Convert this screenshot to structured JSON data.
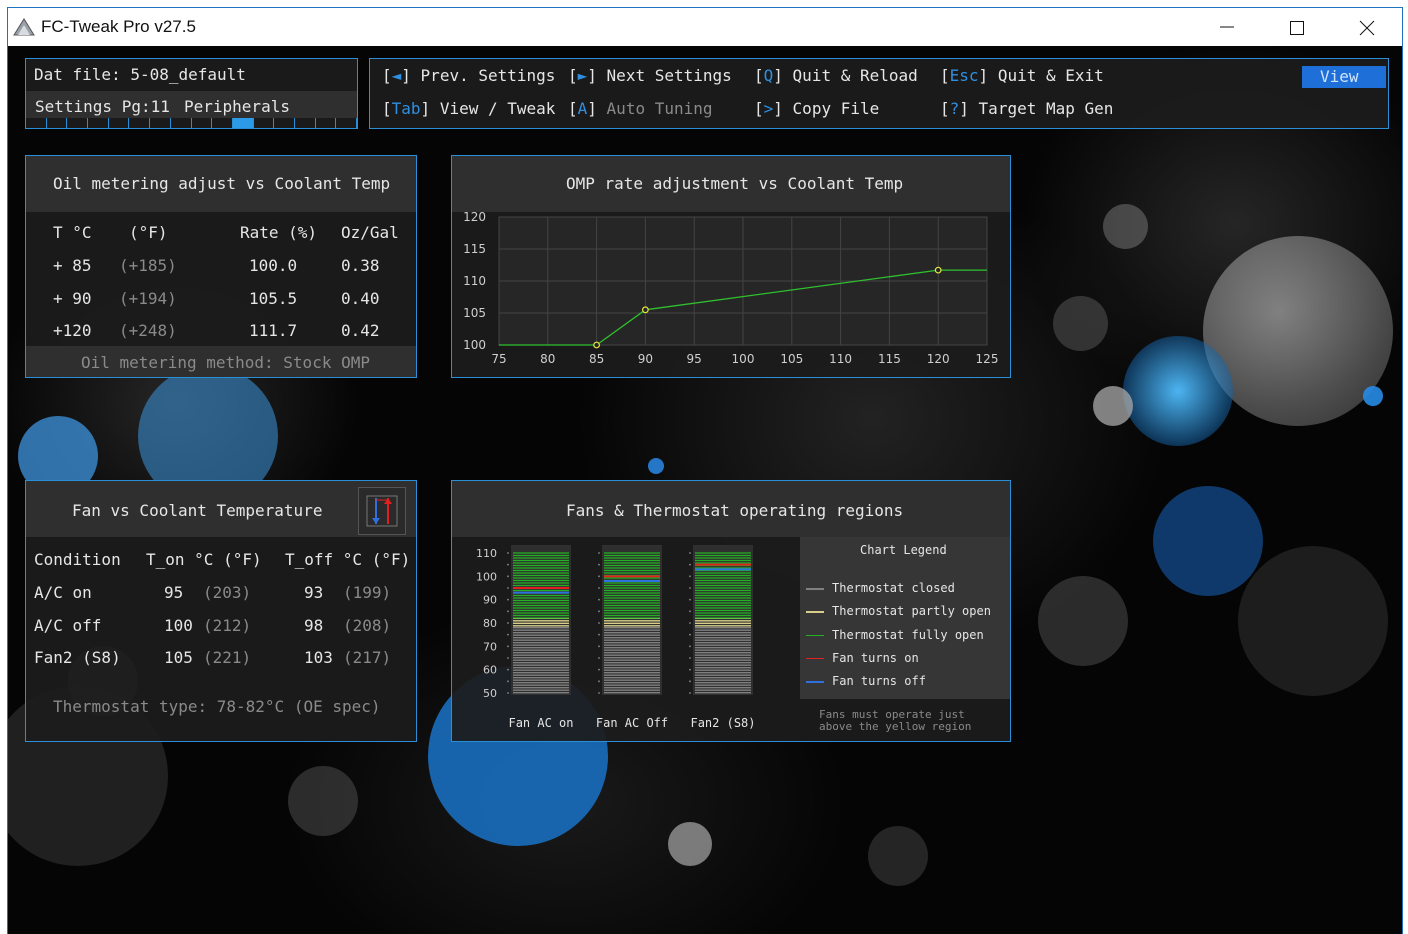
{
  "window": {
    "title": "FC-Tweak Pro v27.5"
  },
  "header": {
    "dat_file": "Dat file: 5-08_default",
    "settings_page": "Settings Pg:11",
    "section": "Peripherals",
    "page_count": 16,
    "current_page": 11
  },
  "commands": [
    {
      "key": "◄",
      "label": "Prev. Settings",
      "muted": false
    },
    {
      "key": "►",
      "label": "Next Settings",
      "muted": false
    },
    {
      "key": "Q",
      "label": "Quit & Reload",
      "muted": false
    },
    {
      "key": "Esc",
      "label": "Quit & Exit",
      "muted": false
    },
    {
      "key": "Tab",
      "label": "View / Tweak",
      "muted": false
    },
    {
      "key": "A",
      "label": "Auto Tuning",
      "muted": true
    },
    {
      "key": ">",
      "label": "Copy File",
      "muted": false
    },
    {
      "key": "?",
      "label": "Target Map Gen",
      "muted": false
    }
  ],
  "mode_button": "View",
  "oil_panel": {
    "title": "Oil metering adjust vs Coolant Temp",
    "headers": [
      "T °C",
      "(°F)",
      "Rate (%)",
      "Oz/Gal"
    ],
    "rows": [
      [
        "+ 85",
        "(+185)",
        "100.0",
        "0.38"
      ],
      [
        "+ 90",
        "(+194)",
        "105.5",
        "0.40"
      ],
      [
        "+120",
        "(+248)",
        "111.7",
        "0.42"
      ]
    ],
    "footer": "Oil metering method: Stock OMP"
  },
  "omp_chart": {
    "title": "OMP rate adjustment vs Coolant Temp"
  },
  "chart_data": [
    {
      "type": "line",
      "title": "OMP rate adjustment vs Coolant Temp",
      "xlabel": "",
      "ylabel": "",
      "xlim": [
        75,
        125
      ],
      "ylim": [
        100,
        120
      ],
      "xticks": [
        "75",
        "80",
        "85",
        "90",
        "95",
        "100",
        "105",
        "110",
        "115",
        "120",
        "125"
      ],
      "yticks": [
        "100",
        "105",
        "110",
        "115",
        "120"
      ],
      "grid": true,
      "series": [
        {
          "x": [
            75,
            85,
            90,
            120,
            125
          ],
          "y": [
            100,
            100,
            105.5,
            111.7,
            111.7
          ],
          "markers_at": [
            85,
            90,
            120
          ],
          "color": "#2fc02f"
        }
      ]
    },
    {
      "type": "bar",
      "title": "Fans & Thermostat operating regions",
      "categories": [
        "Fan AC on",
        "Fan AC Off",
        "Fan2 (S8)"
      ],
      "ylim": [
        50,
        110
      ],
      "yticks": [
        "110",
        "100",
        "90",
        "80",
        "70",
        "60",
        "50"
      ],
      "regions": [
        {
          "name": "Thermostat closed",
          "from": 50,
          "to": 78,
          "color": "#808080"
        },
        {
          "name": "Thermostat partly open",
          "from": 78,
          "to": 82,
          "color": "#d9cf8a"
        },
        {
          "name": "Thermostat fully open",
          "from": 82,
          "to": 110,
          "color": "#24b024"
        }
      ],
      "fan_on": [
        95,
        100,
        105
      ],
      "fan_off": [
        93,
        98,
        103
      ]
    }
  ],
  "fan_panel": {
    "title": "Fan vs Coolant Temperature",
    "headers": [
      "Condition",
      "T_on °C (°F)",
      "T_off °C (°F)"
    ],
    "rows": [
      {
        "cond": "A/C on",
        "on": "95",
        "on_f": "(203)",
        "off": "93",
        "off_f": "(199)"
      },
      {
        "cond": "A/C off",
        "on": "100",
        "on_f": "(212)",
        "off": "98",
        "off_f": "(208)"
      },
      {
        "cond": "Fan2 (S8)",
        "on": "105",
        "on_f": "(221)",
        "off": "103",
        "off_f": "(217)"
      }
    ],
    "footer": "Thermostat type: 78-82°C (OE spec)"
  },
  "regions_panel": {
    "title": "Fans & Thermostat operating regions",
    "legend_title": "Chart Legend",
    "legend": [
      {
        "label": "Thermostat closed",
        "color": "#808080"
      },
      {
        "label": "Thermostat partly open",
        "color": "#d9cf8a"
      },
      {
        "label": "Thermostat fully open",
        "color": "#24b024"
      },
      {
        "label": "Fan turns on",
        "color": "#e02020"
      },
      {
        "label": "Fan turns off",
        "color": "#2f6fe0"
      }
    ],
    "note_line1": "Fans must operate just",
    "note_line2": "above the yellow region"
  }
}
